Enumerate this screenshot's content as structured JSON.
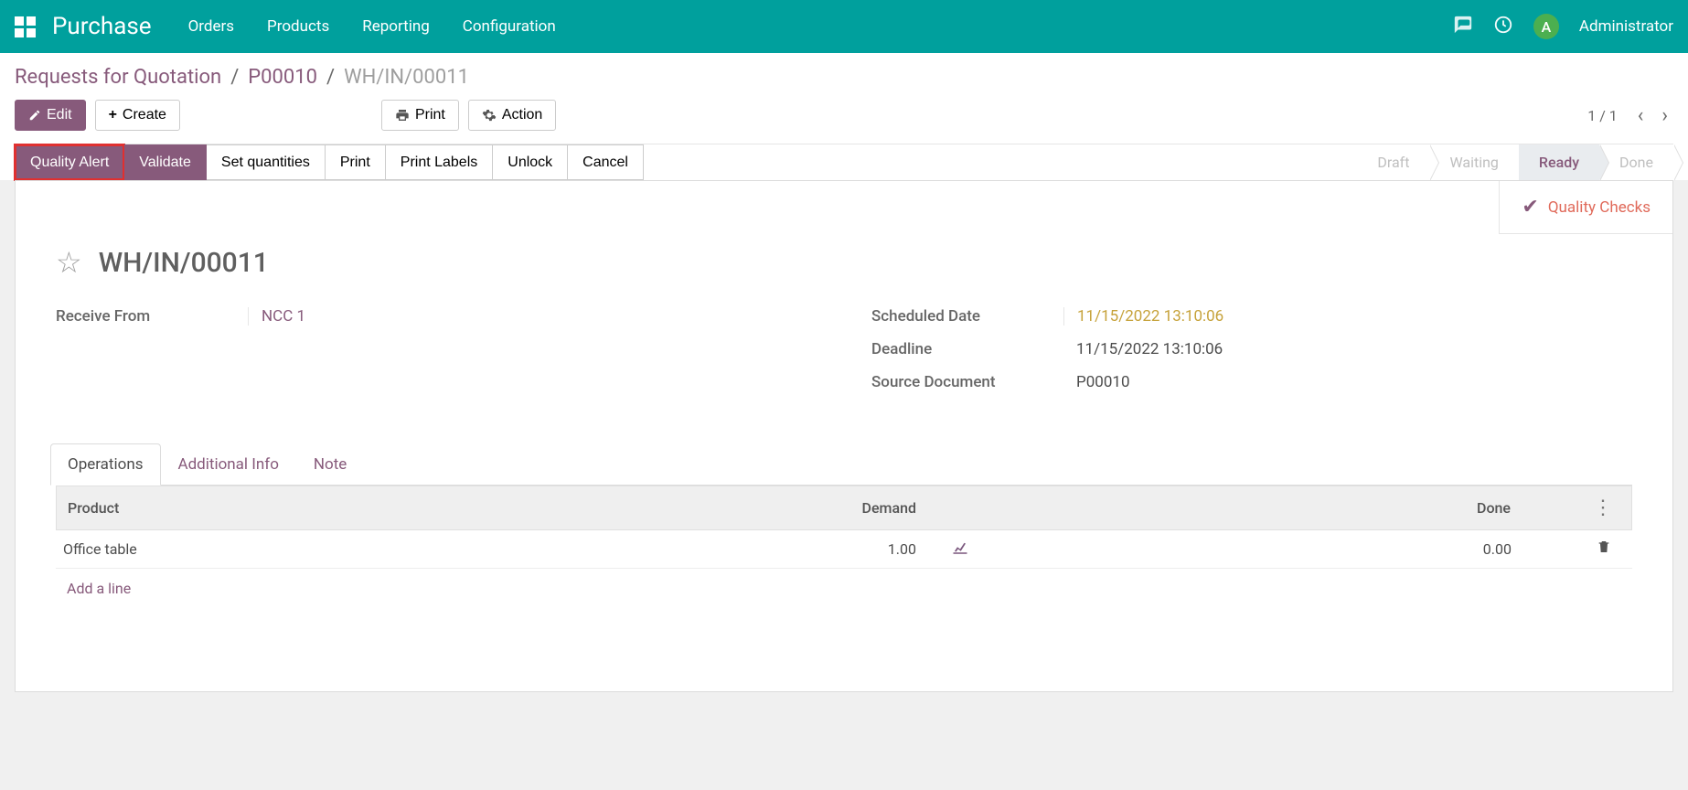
{
  "nav": {
    "module": "Purchase",
    "items": [
      "Orders",
      "Products",
      "Reporting",
      "Configuration"
    ],
    "user_initial": "A",
    "user_name": "Administrator"
  },
  "breadcrumb": {
    "root": "Requests for Quotation",
    "parent": "P00010",
    "current": "WH/IN/00011"
  },
  "toolbar": {
    "edit": "Edit",
    "create": "Create",
    "print": "Print",
    "action": "Action",
    "pager": "1 / 1"
  },
  "status_buttons": {
    "quality_alert": "Quality Alert",
    "validate": "Validate",
    "set_quantities": "Set quantities",
    "print": "Print",
    "print_labels": "Print Labels",
    "unlock": "Unlock",
    "cancel": "Cancel"
  },
  "stages": {
    "draft": "Draft",
    "waiting": "Waiting",
    "ready": "Ready",
    "done": "Done"
  },
  "stat_button": {
    "label": "Quality Checks"
  },
  "record": {
    "title": "WH/IN/00011",
    "receive_from_label": "Receive From",
    "receive_from_value": "NCC 1",
    "scheduled_date_label": "Scheduled Date",
    "scheduled_date_value": "11/15/2022 13:10:06",
    "deadline_label": "Deadline",
    "deadline_value": "11/15/2022 13:10:06",
    "source_doc_label": "Source Document",
    "source_doc_value": "P00010"
  },
  "tabs": {
    "operations": "Operations",
    "additional_info": "Additional Info",
    "note": "Note"
  },
  "grid": {
    "headers": {
      "product": "Product",
      "demand": "Demand",
      "done": "Done"
    },
    "row": {
      "product": "Office table",
      "demand": "1.00",
      "done": "0.00"
    },
    "add_line": "Add a line"
  }
}
